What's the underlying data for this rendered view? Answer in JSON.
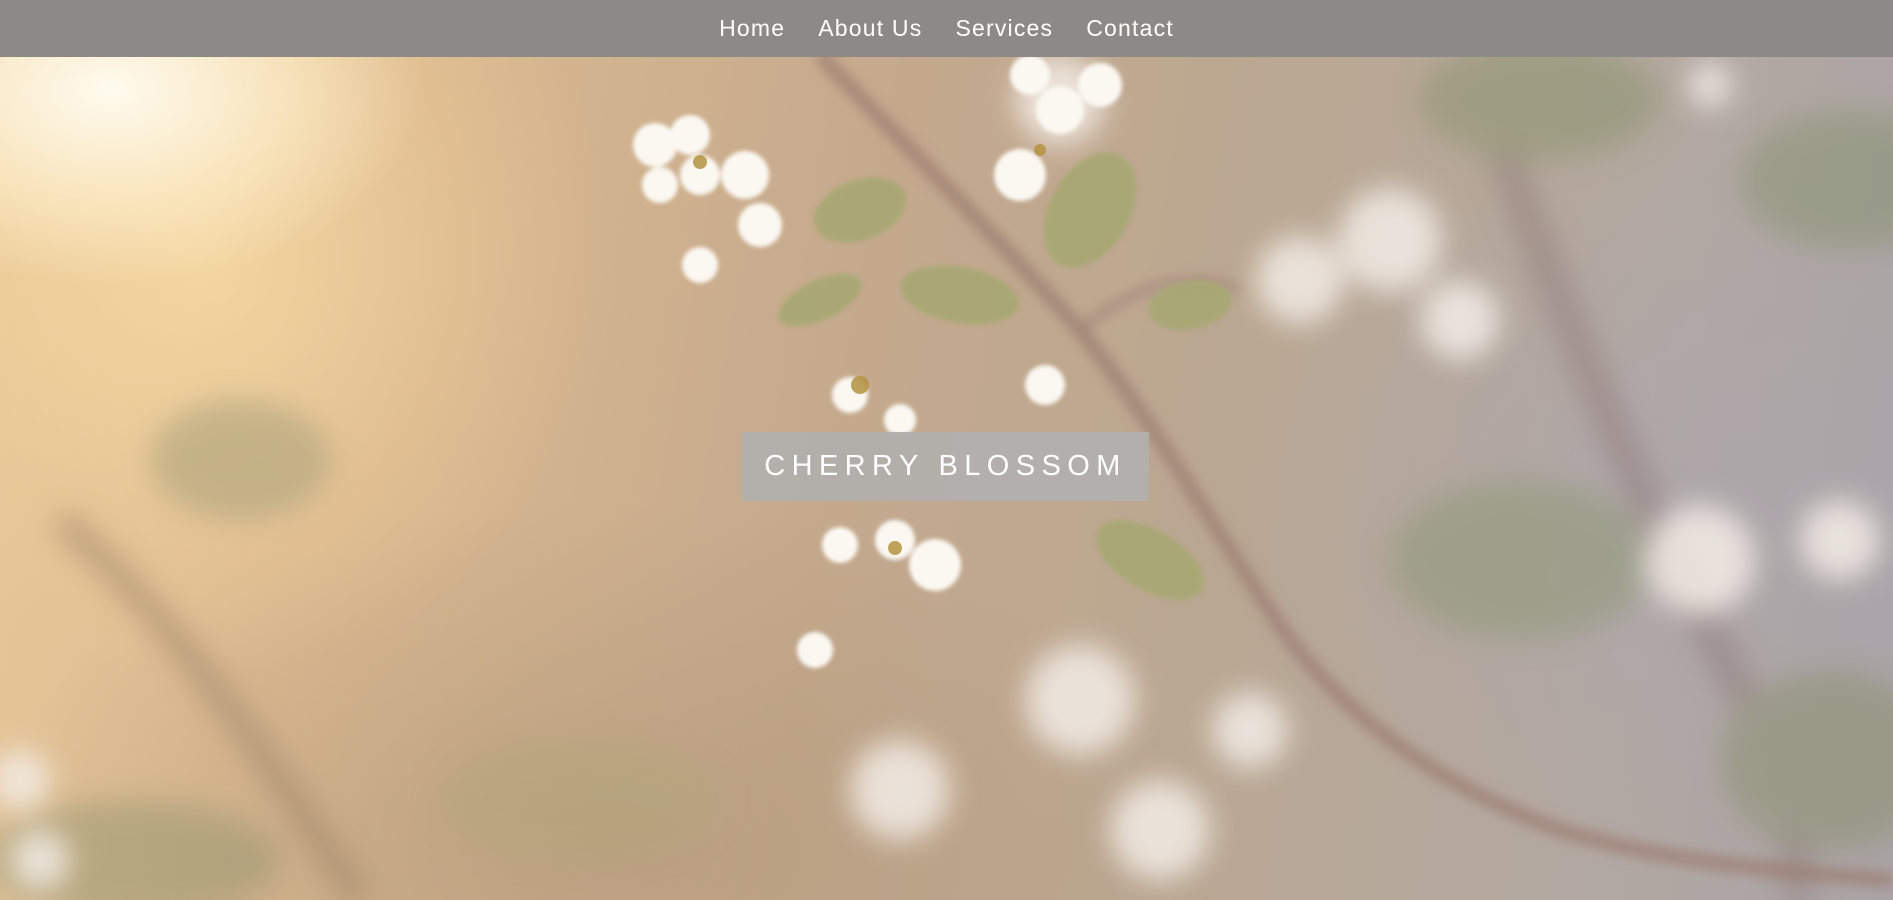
{
  "nav": {
    "items": [
      {
        "label": "Home"
      },
      {
        "label": "About Us"
      },
      {
        "label": "Services"
      },
      {
        "label": "Contact"
      }
    ],
    "background_color": "#8b8a86",
    "text_color": "#ffffff"
  },
  "hero": {
    "title": "CHERRY BLOSSOM",
    "background_image": "cherry-blossom-photo",
    "title_box_color": "#b2b0ac"
  }
}
